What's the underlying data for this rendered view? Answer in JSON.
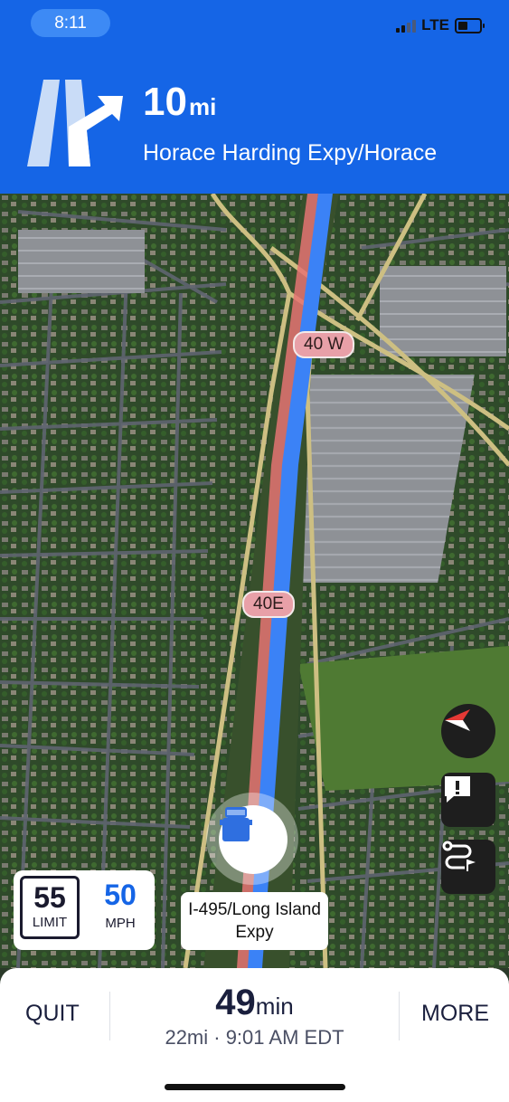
{
  "status_bar": {
    "time": "8:11",
    "network": "LTE"
  },
  "maneuver": {
    "distance_value": "10",
    "distance_unit": "mi",
    "street": "Horace Harding Expy/Horace",
    "icon": "exit-right-arrow-icon"
  },
  "map": {
    "shields": [
      "40 W",
      "40E"
    ],
    "route_color": "#3b82f6",
    "traffic_color": "#e57373"
  },
  "speed": {
    "limit_value": "55",
    "limit_label": "LIMIT",
    "current_value": "50",
    "current_unit": "MPH"
  },
  "current_road": "I-495/Long Island Expy",
  "controls": [
    "compass-icon",
    "report-icon",
    "route-overview-icon"
  ],
  "trip": {
    "quit_label": "QUIT",
    "more_label": "MORE",
    "eta_value": "49",
    "eta_unit": "min",
    "summary": "22mi · 9:01 AM EDT"
  }
}
